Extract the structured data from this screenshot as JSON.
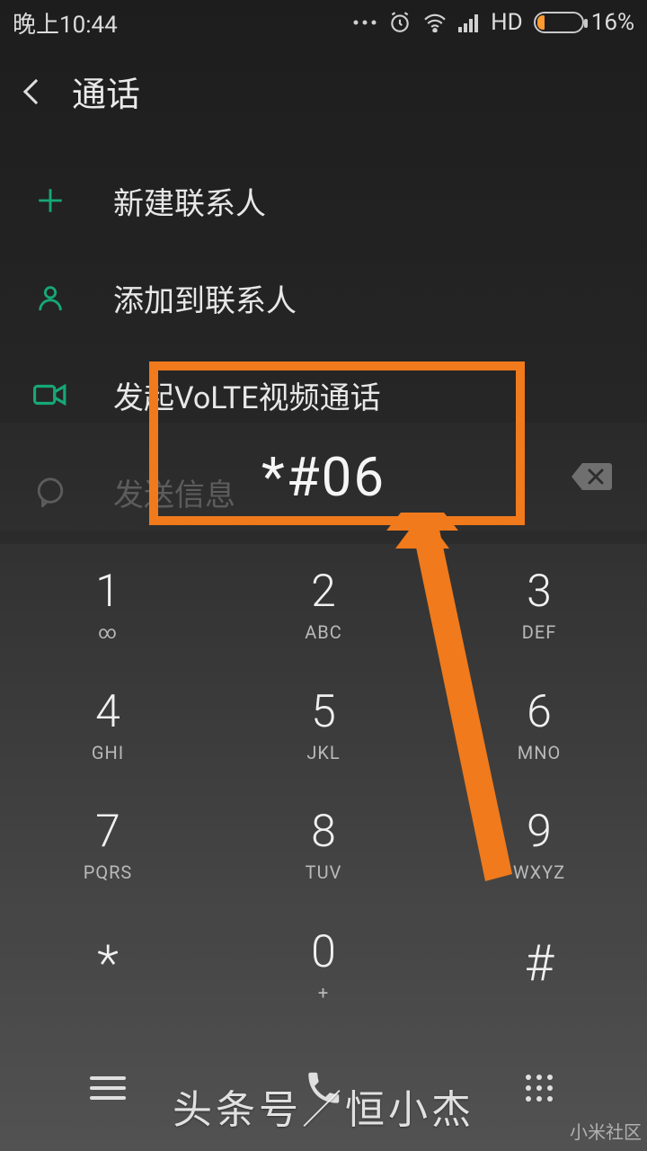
{
  "status": {
    "time": "晚上10:44",
    "hd": "HD",
    "battery_percent": "16%"
  },
  "header": {
    "title": "通话"
  },
  "options": {
    "new_contact": "新建联系人",
    "add_to_contact": "添加到联系人",
    "volte_video": "发起VoLTE视频通话",
    "send_message": "发送信息"
  },
  "dialed": {
    "value": "*#06"
  },
  "keypad": [
    {
      "digit": "1",
      "sub": "∞"
    },
    {
      "digit": "2",
      "sub": "ABC"
    },
    {
      "digit": "3",
      "sub": "DEF"
    },
    {
      "digit": "4",
      "sub": "GHI"
    },
    {
      "digit": "5",
      "sub": "JKL"
    },
    {
      "digit": "6",
      "sub": "MNO"
    },
    {
      "digit": "7",
      "sub": "PQRS"
    },
    {
      "digit": "8",
      "sub": "TUV"
    },
    {
      "digit": "9",
      "sub": "WXYZ"
    },
    {
      "digit": "*",
      "sub": ""
    },
    {
      "digit": "0",
      "sub": "+"
    },
    {
      "digit": "#",
      "sub": ""
    }
  ],
  "watermark": {
    "center": "头条号／恒小杰",
    "corner": "小米社区"
  },
  "accent": "#16a877",
  "highlight_color": "#f07a1c"
}
